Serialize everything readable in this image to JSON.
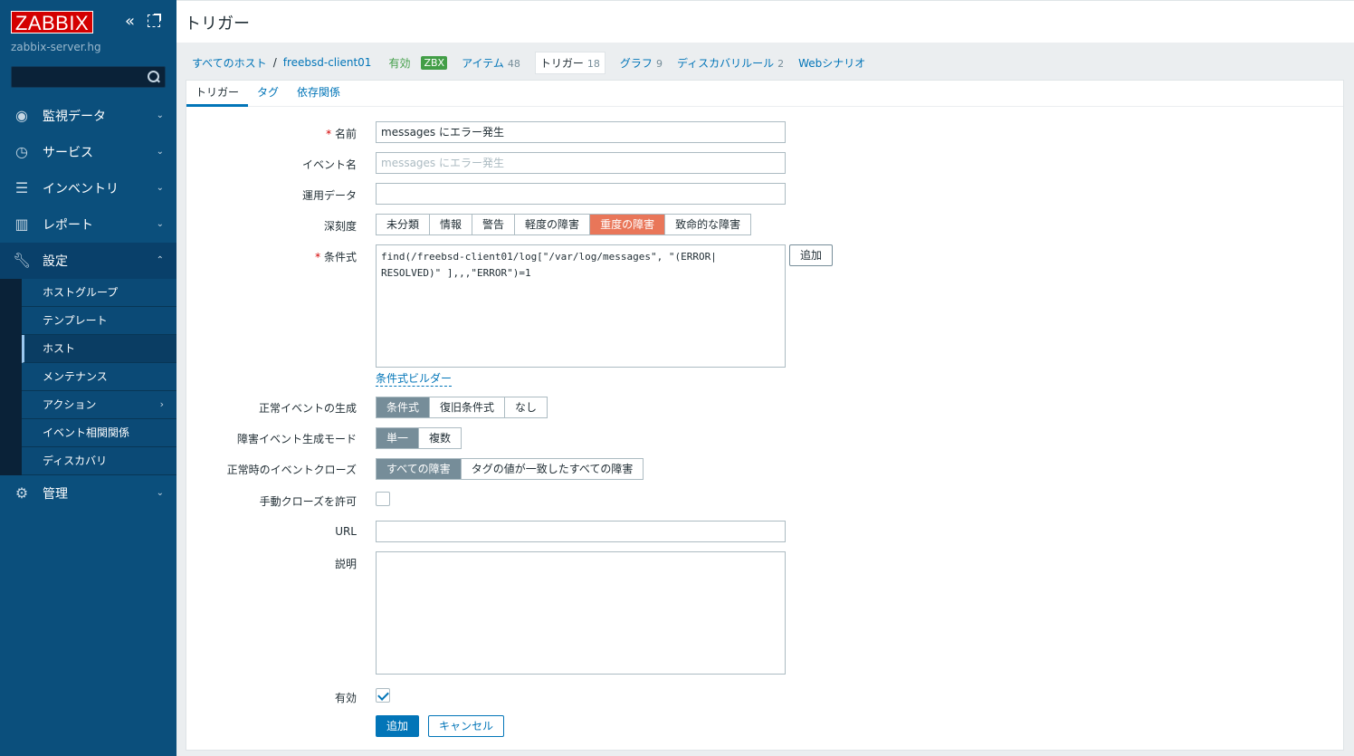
{
  "sidebar": {
    "logo": "ZABBIX",
    "server_name": "zabbix-server.hg",
    "search_value": "",
    "nav": [
      {
        "label": "監視データ",
        "icon": "eye-icon"
      },
      {
        "label": "サービス",
        "icon": "stopwatch-icon"
      },
      {
        "label": "インベントリ",
        "icon": "list-icon"
      },
      {
        "label": "レポート",
        "icon": "bar-chart-icon"
      },
      {
        "label": "設定",
        "icon": "wrench-icon"
      },
      {
        "label": "管理",
        "icon": "gear-icon"
      }
    ],
    "config_sub": [
      "ホストグループ",
      "テンプレート",
      "ホスト",
      "メンテナンス",
      "アクション",
      "イベント相関関係",
      "ディスカバリ"
    ]
  },
  "header": {
    "title": "トリガー"
  },
  "breadcrumb": {
    "all_hosts": "すべてのホスト",
    "sep": "/",
    "host": "freebsd-client01",
    "status": "有効",
    "badge": "ZBX",
    "items_label": "アイテム",
    "items_count": "48",
    "triggers_label": "トリガー",
    "triggers_count": "18",
    "graphs_label": "グラフ",
    "graphs_count": "9",
    "discovery_label": "ディスカバリルール",
    "discovery_count": "2",
    "web_label": "Webシナリオ"
  },
  "tabs": [
    "トリガー",
    "タグ",
    "依存関係"
  ],
  "form": {
    "name_label": "名前",
    "name_value": "messages にエラー発生",
    "event_name_label": "イベント名",
    "event_name_placeholder": "messages にエラー発生",
    "opdata_label": "運用データ",
    "opdata_value": "",
    "severity_label": "深刻度",
    "severities": [
      "未分類",
      "情報",
      "警告",
      "軽度の障害",
      "重度の障害",
      "致命的な障害"
    ],
    "expression_label": "条件式",
    "expression_value": "find(/freebsd-client01/log[\"/var/log/messages\", \"(ERROR|\nRESOLVED)\" ],,,\"ERROR\")=1",
    "expression_add": "追加",
    "expression_builder": "条件式ビルダー",
    "ok_event_label": "正常イベントの生成",
    "ok_event_options": [
      "条件式",
      "復旧条件式",
      "なし"
    ],
    "problem_mode_label": "障害イベント生成モード",
    "problem_mode_options": [
      "単一",
      "複数"
    ],
    "ok_close_label": "正常時のイベントクローズ",
    "ok_close_options": [
      "すべての障害",
      "タグの値が一致したすべての障害"
    ],
    "manual_close_label": "手動クローズを許可",
    "url_label": "URL",
    "url_value": "",
    "description_label": "説明",
    "description_value": "",
    "enabled_label": "有効",
    "submit": "追加",
    "cancel": "キャンセル"
  },
  "colors": {
    "sidebar": "#0b4f7c",
    "severity_high": "#e97659",
    "link": "#0275b8",
    "enabled": "#429e47"
  }
}
